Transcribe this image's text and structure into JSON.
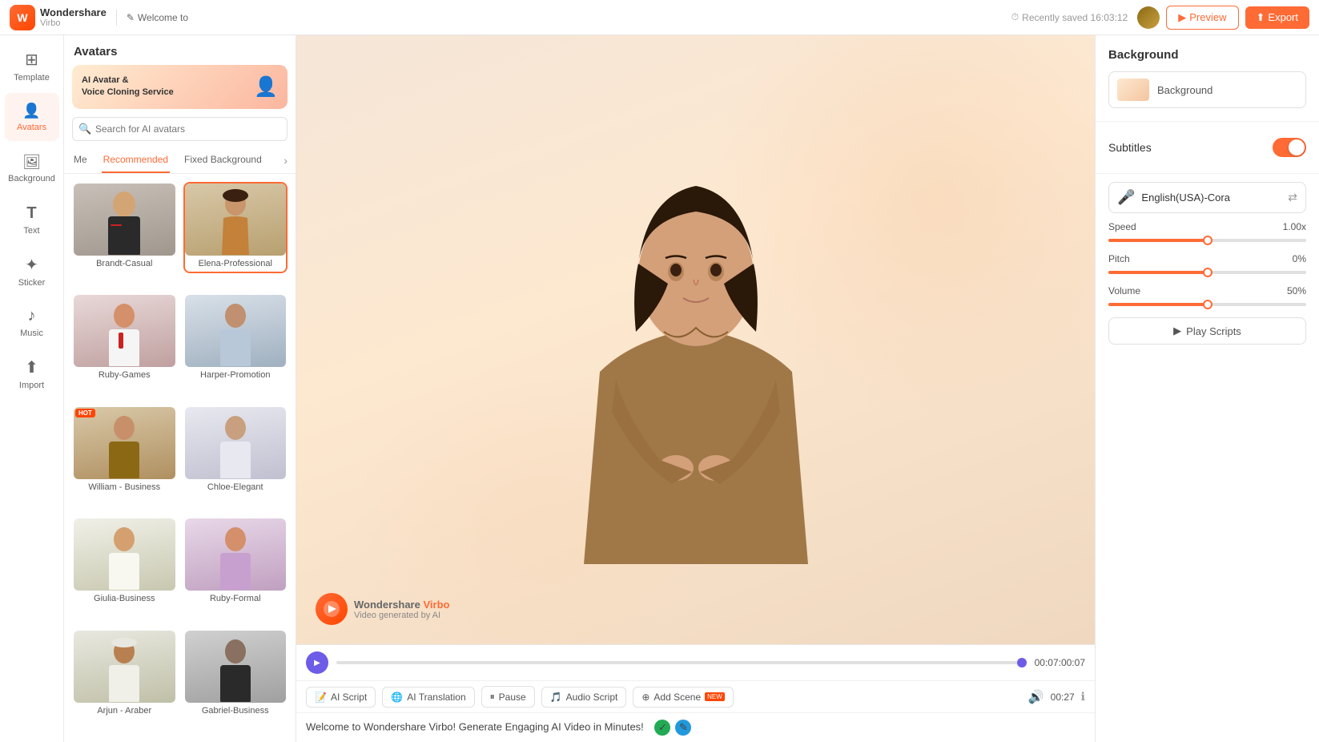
{
  "app": {
    "name": "Wondershare",
    "sub": "Virbo",
    "welcome": "Welcome to"
  },
  "topbar": {
    "saved_text": "Recently saved 16:03:12",
    "preview_label": "Preview",
    "export_label": "Export"
  },
  "sidebar": {
    "items": [
      {
        "id": "template",
        "label": "Template",
        "icon": "⊞"
      },
      {
        "id": "avatars",
        "label": "Avatars",
        "icon": "👤"
      },
      {
        "id": "background",
        "label": "Background",
        "icon": "🖼"
      },
      {
        "id": "text",
        "label": "Text",
        "icon": "T"
      },
      {
        "id": "sticker",
        "label": "Sticker",
        "icon": "✦"
      },
      {
        "id": "music",
        "label": "Music",
        "icon": "♪"
      },
      {
        "id": "import",
        "label": "Import",
        "icon": "⬆"
      }
    ]
  },
  "avatars_panel": {
    "title": "Avatars",
    "banner_text": "AI Avatar &\nVoice Cloning Service",
    "search_placeholder": "Search for AI avatars",
    "tabs": [
      {
        "id": "me",
        "label": "Me"
      },
      {
        "id": "recommended",
        "label": "Recommended"
      },
      {
        "id": "fixed_bg",
        "label": "Fixed Background"
      }
    ],
    "avatars": [
      {
        "id": "brandt",
        "name": "Brandt-Casual",
        "bg": "#e0d8d0",
        "hot": false,
        "selected": false
      },
      {
        "id": "elena",
        "name": "Elena-Professional",
        "bg": "#d8c8b0",
        "hot": false,
        "selected": true
      },
      {
        "id": "ruby",
        "name": "Ruby-Games",
        "bg": "#e8d8d8",
        "hot": false,
        "selected": false
      },
      {
        "id": "harper",
        "name": "Harper-Promotion",
        "bg": "#d8e0e8",
        "hot": false,
        "selected": false
      },
      {
        "id": "william",
        "name": "William - Business",
        "bg": "#d8c8a8",
        "hot": true,
        "selected": false
      },
      {
        "id": "chloe",
        "name": "Chloe-Elegant",
        "bg": "#e8e8f0",
        "hot": false,
        "selected": false
      },
      {
        "id": "giulia",
        "name": "Giulia-Business",
        "bg": "#f0f0e8",
        "hot": false,
        "selected": false
      },
      {
        "id": "ruby2",
        "name": "Ruby-Formal",
        "bg": "#e8d8e8",
        "hot": false,
        "selected": false
      },
      {
        "id": "arjun",
        "name": "Arjun - Araber",
        "bg": "#e8e8e0",
        "hot": false,
        "selected": false
      },
      {
        "id": "gabriel",
        "name": "Gabriel-Business",
        "bg": "#d0d0d0",
        "hot": false,
        "selected": false
      }
    ]
  },
  "video": {
    "watermark_name": "Wondershare",
    "watermark_brand": "Virbo",
    "watermark_sub": "Video generated by AI"
  },
  "timeline": {
    "time_current": "00:07:00:07",
    "fill_percent": 0
  },
  "script_toolbar": {
    "ai_script_label": "AI Script",
    "ai_translation_label": "AI Translation",
    "pause_label": "Pause",
    "audio_script_label": "Audio Script",
    "add_scene_label": "Add Scene",
    "time_display": "00:27",
    "script_text": "Welcome to Wondershare Virbo! Generate Engaging AI Video in Minutes!"
  },
  "right_panel": {
    "background_title": "Background",
    "background_item_label": "Background",
    "subtitles_label": "Subtitles",
    "subtitles_enabled": true,
    "voice_selector": {
      "label": "English(USA)-Cora"
    },
    "speed": {
      "label": "Speed",
      "value": "1.00x",
      "percent": 50
    },
    "pitch": {
      "label": "Pitch",
      "value": "0%",
      "percent": 50
    },
    "volume": {
      "label": "Volume",
      "value": "50%",
      "percent": 50
    },
    "play_scripts_label": "Play Scripts"
  }
}
